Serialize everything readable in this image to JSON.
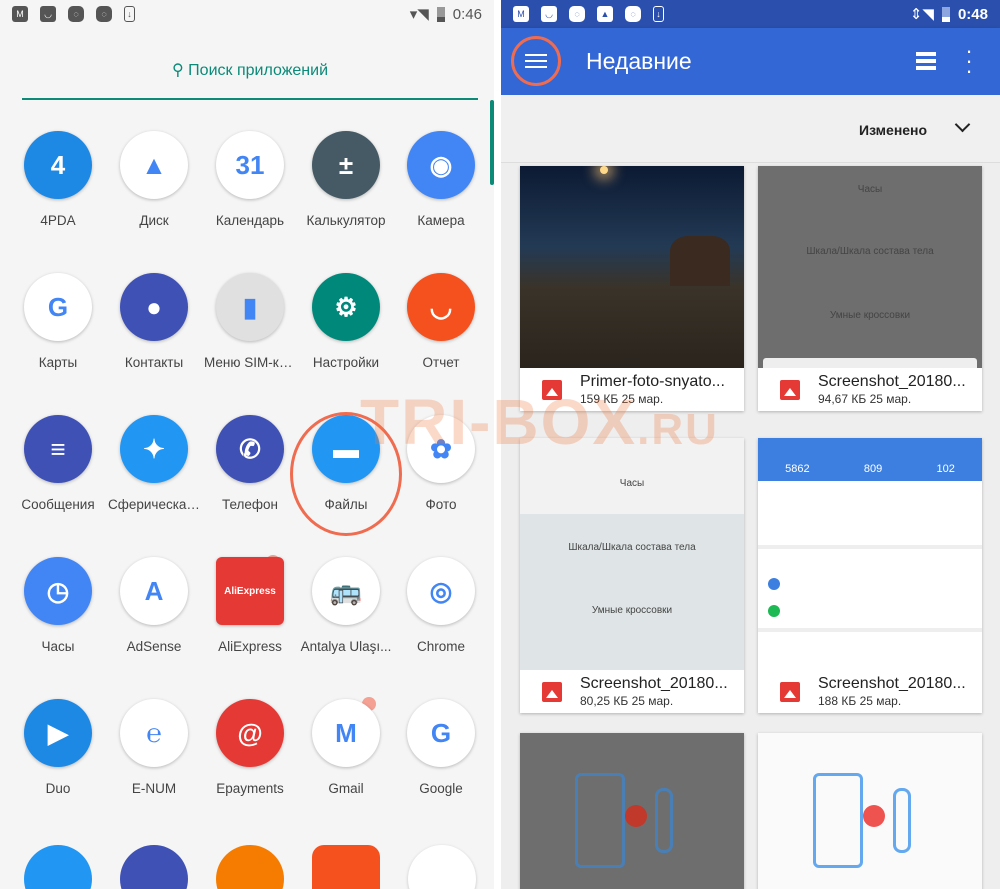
{
  "left": {
    "status": {
      "time": "0:46",
      "icons": [
        "gmail-icon",
        "smile-icon",
        "fm-icon",
        "fm-icon",
        "download-icon"
      ]
    },
    "search_label": "Поиск приложений",
    "apps": [
      {
        "label": "4PDA",
        "color": "#1e88e5",
        "glyph": "4"
      },
      {
        "label": "Диск",
        "color": "#ffffff",
        "glyph": "▲"
      },
      {
        "label": "Календарь",
        "color": "#ffffff",
        "glyph": "31"
      },
      {
        "label": "Калькулятор",
        "color": "#455a64",
        "glyph": "±"
      },
      {
        "label": "Камера",
        "color": "#4285f4",
        "glyph": "◉"
      },
      {
        "label": "Карты",
        "color": "#ffffff",
        "glyph": "G"
      },
      {
        "label": "Контакты",
        "color": "#3f51b5",
        "glyph": "●"
      },
      {
        "label": "Меню SIM-ка...",
        "color": "#e0e0e0",
        "glyph": "▮"
      },
      {
        "label": "Настройки",
        "color": "#00897b",
        "glyph": "⚙"
      },
      {
        "label": "Отчет",
        "color": "#f4511e",
        "glyph": "◡"
      },
      {
        "label": "Сообщения",
        "color": "#3f51b5",
        "glyph": "≡"
      },
      {
        "label": "Сферическая...",
        "color": "#2196f3",
        "glyph": "✦"
      },
      {
        "label": "Телефон",
        "color": "#3f51b5",
        "glyph": "✆"
      },
      {
        "label": "Файлы",
        "color": "#2196f3",
        "glyph": "▬"
      },
      {
        "label": "Фото",
        "color": "#ffffff",
        "glyph": "✿"
      },
      {
        "label": "Часы",
        "color": "#4285f4",
        "glyph": "◷"
      },
      {
        "label": "AdSense",
        "color": "#ffffff",
        "glyph": "A"
      },
      {
        "label": "AliExpress",
        "color": "#e53935",
        "glyph": "AliExpress"
      },
      {
        "label": "Antalya Ulaşı...",
        "color": "#ffffff",
        "glyph": "🚌"
      },
      {
        "label": "Chrome",
        "color": "#ffffff",
        "glyph": "◎"
      },
      {
        "label": "Duo",
        "color": "#1e88e5",
        "glyph": "▶"
      },
      {
        "label": "E-NUM",
        "color": "#ffffff",
        "glyph": "℮"
      },
      {
        "label": "Epayments",
        "color": "#e53935",
        "glyph": "@"
      },
      {
        "label": "Gmail",
        "color": "#ffffff",
        "glyph": "M"
      },
      {
        "label": "Google",
        "color": "#ffffff",
        "glyph": "G"
      }
    ]
  },
  "right": {
    "status": {
      "time": "0:48"
    },
    "title": "Недавние",
    "sort_label": "Изменено",
    "files": [
      {
        "name": "Primer-foto-snyato...",
        "size": "159 КБ",
        "date": "25 мар."
      },
      {
        "name": "Screenshot_20180...",
        "size": "94,67 КБ",
        "date": "25 мар.",
        "lines": [
          "Часы",
          "Шкала/Шкала состава тела",
          "Умные кроссовки"
        ]
      },
      {
        "name": "Screenshot_20180...",
        "size": "80,25 КБ",
        "date": "25 мар.",
        "lines": [
          "Часы",
          "Шкала/Шкала состава тела",
          "Умные кроссовки"
        ]
      },
      {
        "name": "Screenshot_20180...",
        "size": "188 КБ",
        "date": "25 мар.",
        "stats": [
          "5862",
          "809",
          "102"
        ]
      }
    ]
  },
  "watermark": "TRI-BOX.RU",
  "colors": {
    "teal": "#0b8a78",
    "appbar": "#3367d6",
    "highlight": "#ef6c50"
  }
}
